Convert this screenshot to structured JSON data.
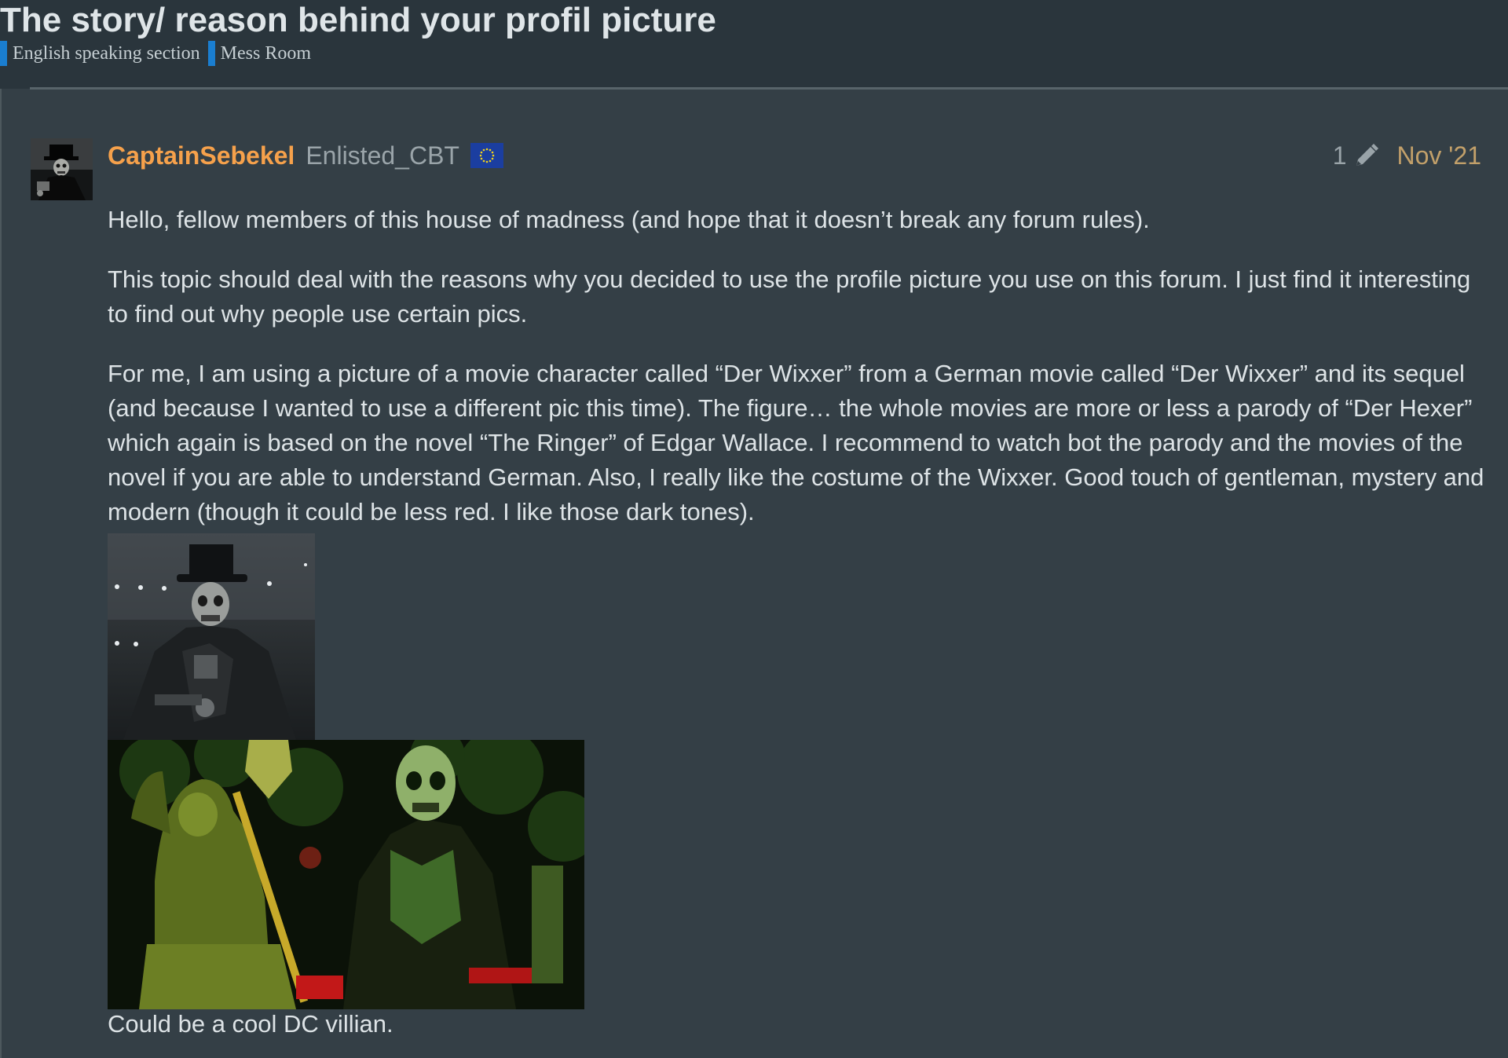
{
  "topic": {
    "title": "The story/ reason behind your profil picture",
    "breadcrumbs": [
      {
        "label": "English speaking section",
        "color": "#1a7ed0"
      },
      {
        "label": "Mess Room",
        "color": "#1a7ed0"
      }
    ]
  },
  "post": {
    "username": "CaptainSebekel",
    "user_title": "Enlisted_CBT",
    "flag_icon": "eu-flag-icon",
    "edit_count": "1",
    "edit_icon": "pencil-icon",
    "date": "Nov '21",
    "paragraphs": [
      "Hello, fellow members of this house of madness (and hope that it doesn’t break any forum rules).",
      "This topic should deal with the reasons why you decided to use the profile picture you use on this forum. I just find it interesting to find out why people use certain pics.",
      "For me, I am using a picture of a movie character called “Der Wixxer” from a German movie called “Der Wixxer” and its sequel (and because I wanted to use a different pic this time). The figure… the whole movies are more or less a parody of “Der Hexer” which again is based on the novel “The Ringer” of Edgar Wallace. I recommend to watch bot the parody and the movies of the novel if you are able to understand German. Also, I really like the costume of the Wixxer. Good touch of gentleman, mystery and modern (though it could be less red. I like those dark tones)."
    ],
    "caption": "Could be a cool DC villian."
  },
  "colors": {
    "background": "#343f46",
    "header_background": "#2a353c",
    "username": "#f6a14b",
    "date": "#c2a06a",
    "category_bar": "#1a7ed0"
  }
}
